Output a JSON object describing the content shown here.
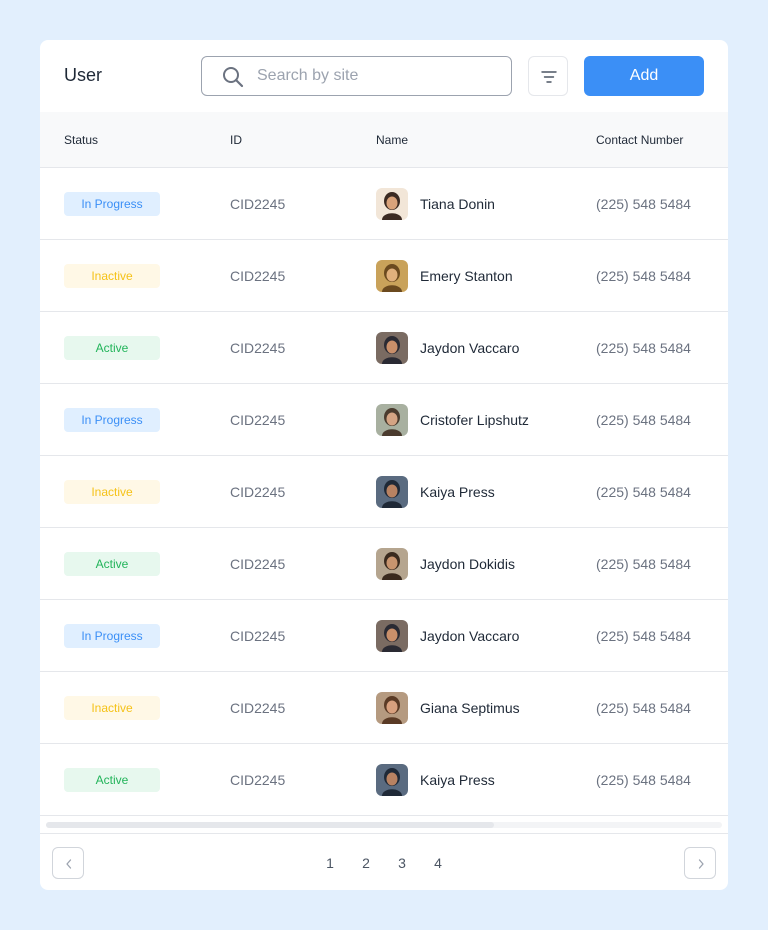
{
  "header": {
    "title": "User",
    "search_placeholder": "Search by site",
    "search_value": "",
    "add_label": "Add",
    "accent_color": "#3b8ff6"
  },
  "table": {
    "columns": [
      "Status",
      "ID",
      "Name",
      "Contact Number"
    ],
    "rows": [
      {
        "status": "In Progress",
        "status_type": "progress",
        "id": "CID2245",
        "name": "Tiana Donin",
        "phone": "(225) 548 5484"
      },
      {
        "status": "Inactive",
        "status_type": "inactive",
        "id": "CID2245",
        "name": "Emery Stanton",
        "phone": "(225) 548 5484"
      },
      {
        "status": "Active",
        "status_type": "active",
        "id": "CID2245",
        "name": "Jaydon Vaccaro",
        "phone": "(225) 548 5484"
      },
      {
        "status": "In Progress",
        "status_type": "progress",
        "id": "CID2245",
        "name": "Cristofer Lipshutz",
        "phone": "(225) 548 5484"
      },
      {
        "status": "Inactive",
        "status_type": "inactive",
        "id": "CID2245",
        "name": "Kaiya Press",
        "phone": "(225) 548 5484"
      },
      {
        "status": "Active",
        "status_type": "active",
        "id": "CID2245",
        "name": "Jaydon Dokidis",
        "phone": "(225) 548 5484"
      },
      {
        "status": "In Progress",
        "status_type": "progress",
        "id": "CID2245",
        "name": "Jaydon Vaccaro",
        "phone": "(225) 548 5484"
      },
      {
        "status": "Inactive",
        "status_type": "inactive",
        "id": "CID2245",
        "name": "Giana Septimus",
        "phone": "(225) 548 5484"
      },
      {
        "status": "Active",
        "status_type": "active",
        "id": "CID2245",
        "name": "Kaiya Press",
        "phone": "(225) 548 5484"
      }
    ]
  },
  "status_colors": {
    "progress": {
      "bg": "#e0efff",
      "fg": "#3b8ff6"
    },
    "inactive": {
      "bg": "#fff8e6",
      "fg": "#f5c218"
    },
    "active": {
      "bg": "#e7f8ee",
      "fg": "#22b45a"
    }
  },
  "pagination": {
    "pages": [
      "1",
      "2",
      "3",
      "4"
    ],
    "prev_icon": "chevron-left-icon",
    "next_icon": "chevron-right-icon"
  },
  "icons": {
    "search": "search-icon",
    "filter": "filter-icon"
  }
}
